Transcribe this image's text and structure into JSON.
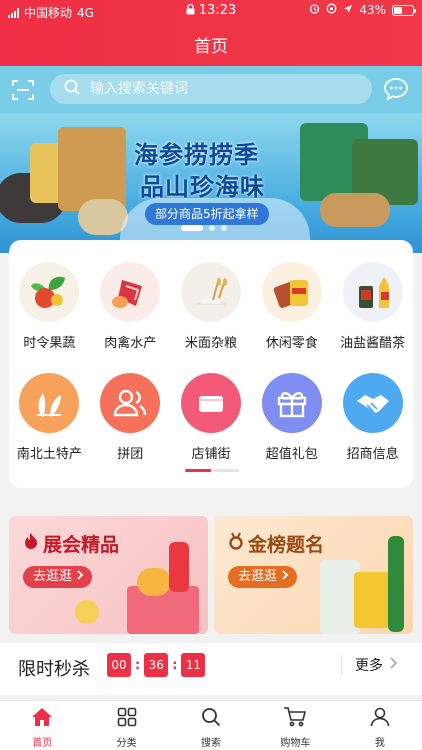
{
  "status_bar": {
    "carrier": "中国移动",
    "network": "4G",
    "time": "13:23",
    "battery": "43%",
    "battery_level": 0.43
  },
  "header": {
    "title": "首页"
  },
  "search": {
    "placeholder": "输入搜索关键词"
  },
  "banner": {
    "headline_1": "海参捞捞季",
    "headline_2": "品山珍海味",
    "tagline": "部分商品5折起拿样",
    "slide_count": 3,
    "active_slide": 1
  },
  "categories": [
    {
      "label": "时令果蔬",
      "icon": "vegetables-icon",
      "color": "#f6f1e6"
    },
    {
      "label": "肉禽水产",
      "icon": "meat-icon",
      "color": "#fbecea"
    },
    {
      "label": "米面杂粮",
      "icon": "grain-icon",
      "color": "#f3f0e9"
    },
    {
      "label": "休闲零食",
      "icon": "snacks-icon",
      "color": "#fbefe0"
    },
    {
      "label": "油盐酱醋茶",
      "icon": "condiment-icon",
      "color": "#eef2f6"
    },
    {
      "label": "南北土特产",
      "icon": "specialty-icon",
      "color": "#f7a25a"
    },
    {
      "label": "拼团",
      "icon": "group-buy-icon",
      "color": "#f5715a"
    },
    {
      "label": "店铺街",
      "icon": "store-icon",
      "color": "#f25a78"
    },
    {
      "label": "超值礼包",
      "icon": "gift-icon",
      "color": "#7f8ef0"
    },
    {
      "label": "招商信息",
      "icon": "handshake-icon",
      "color": "#4fa9f0"
    }
  ],
  "promos": {
    "expo": {
      "title": "展会精品",
      "button": "去逛逛"
    },
    "ranking": {
      "title": "金榜题名",
      "button": "去逛逛"
    }
  },
  "flash_sale": {
    "title": "限时秒杀",
    "hours": "00",
    "minutes": "36",
    "seconds": "11",
    "more": "更多"
  },
  "tabs": [
    {
      "label": "首页",
      "icon": "home-icon",
      "active": true
    },
    {
      "label": "分类",
      "icon": "grid-icon",
      "active": false
    },
    {
      "label": "搜索",
      "icon": "search-icon",
      "active": false
    },
    {
      "label": "购物车",
      "icon": "cart-icon",
      "active": false
    },
    {
      "label": "我",
      "icon": "profile-icon",
      "active": false
    }
  ],
  "colors": {
    "brand": "#ef2f45",
    "search_band": "#79cde6"
  }
}
